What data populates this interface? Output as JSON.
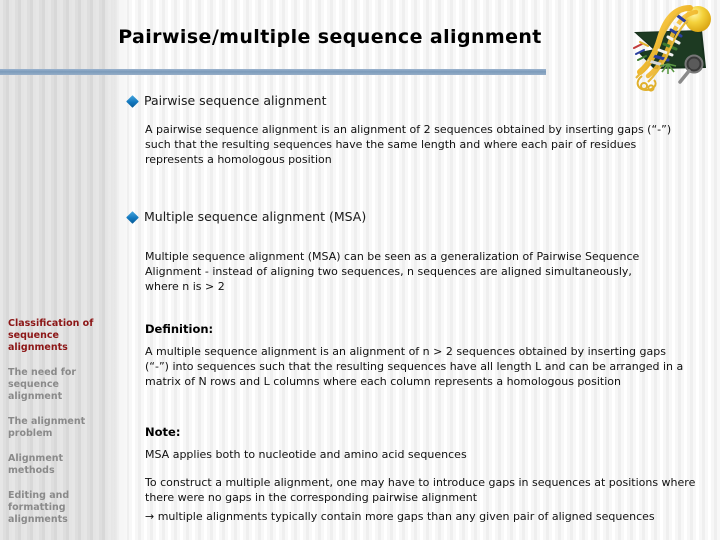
{
  "slide": {
    "title": "Pairwise/multiple sequence alignment",
    "clipart_name": "dna-helix-clipart"
  },
  "sidebar": {
    "items": [
      {
        "label": "Classification of sequence alignments",
        "active": true
      },
      {
        "label": "The need for sequence alignment",
        "active": false
      },
      {
        "label": "The alignment problem",
        "active": false
      },
      {
        "label": "Alignment methods",
        "active": false
      },
      {
        "label": "Editing and formatting alignments",
        "active": false
      }
    ]
  },
  "content": {
    "bullet_1": "Pairwise sequence alignment",
    "para_1": "A pairwise sequence alignment is an alignment of 2 sequences obtained by inserting gaps (“-”) such that the resulting sequences have the same length and where each pair of residues represents a homologous position",
    "bullet_2": "Multiple sequence alignment (MSA)",
    "para_2": "Multiple sequence alignment (MSA) can be seen as a generalization of Pairwise Sequence Alignment - instead of aligning two sequences, n sequences are aligned simultaneously, where n is > 2",
    "definition_heading": "Definition:",
    "definition_para": "A multiple sequence alignment is an alignment of n > 2 sequences obtained by inserting gaps (“-”) into sequences such that the resulting sequences have all length L and can be arranged in a matrix  of N rows and L columns where each column represents a homologous position",
    "note_heading": "Note:",
    "note_para": "MSA applies both to nucleotide and amino acid sequences",
    "construct_para": "To construct a multiple alignment, one may have to introduce gaps in sequences at positions where there were no gaps in the corresponding pairwise alignment",
    "arrow_para": "→  multiple alignments typically contain more gaps than any given pair of aligned sequences"
  },
  "colors": {
    "active_nav": "#8c1616",
    "inactive_nav": "#8a8a8a",
    "divider": "#7c9bbb",
    "bullet": "#1277bd"
  }
}
